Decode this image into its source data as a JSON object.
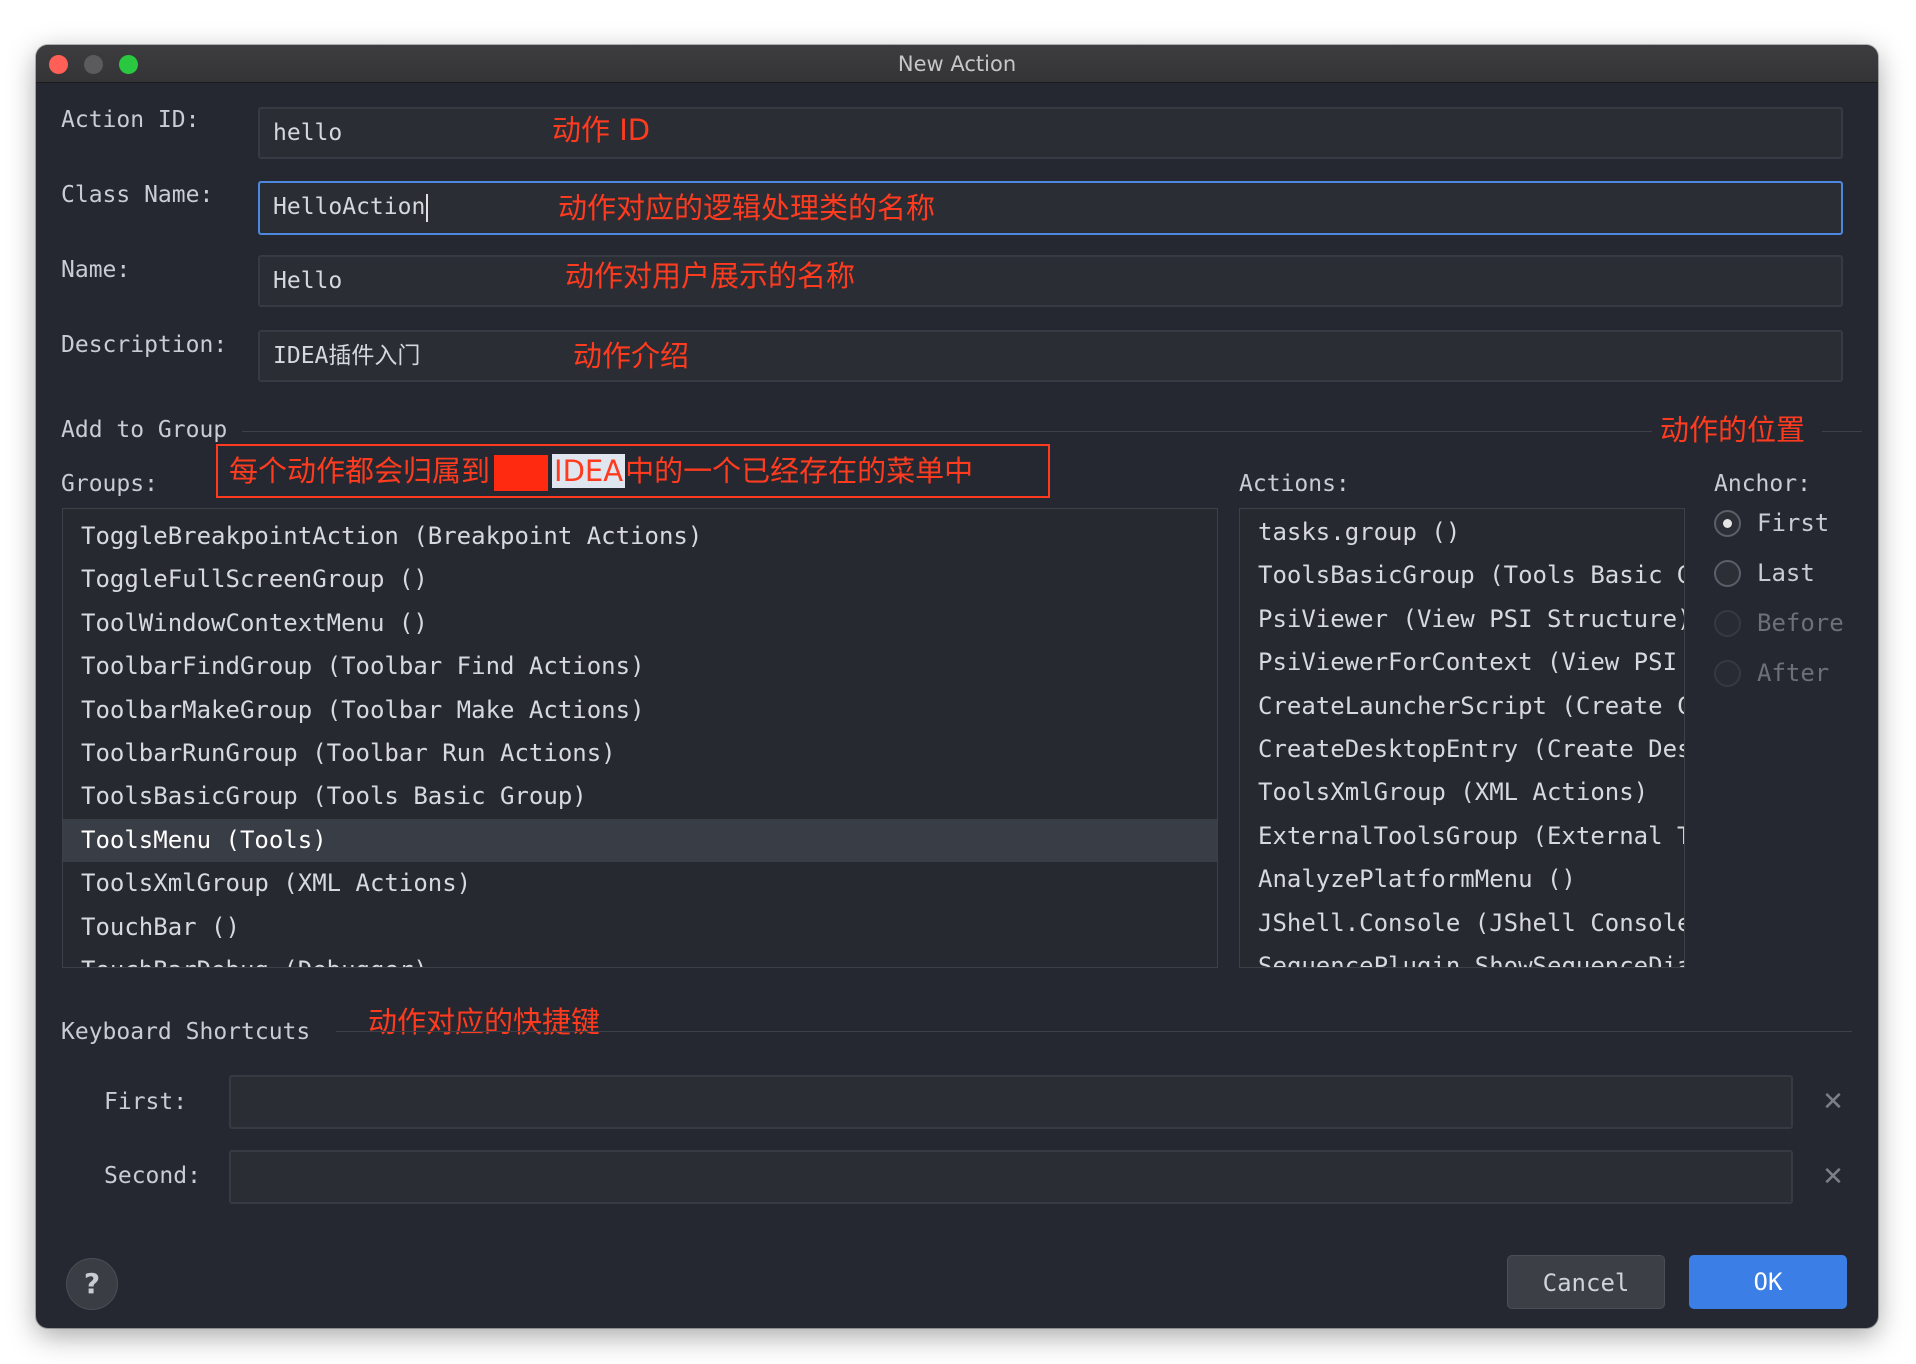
{
  "window": {
    "title": "New Action"
  },
  "form": {
    "action_id": {
      "label": "Action ID:",
      "value": "hello"
    },
    "class_name": {
      "label": "Class Name:",
      "value": "HelloAction"
    },
    "name": {
      "label": "Name:",
      "value": "Hello"
    },
    "description": {
      "label": "Description:",
      "value": "IDEA插件入门"
    }
  },
  "annotations": {
    "action_id": "动作 ID",
    "class_name": "动作对应的逻辑处理类的名称",
    "name": "动作对用户展示的名称",
    "description": "动作介绍",
    "groups_before": "每个动作都会归属到",
    "groups_highlight": "IDEA",
    "groups_after": "中的一个已经存在的菜单中",
    "anchor": "动作的位置",
    "shortcuts": "动作对应的快捷键"
  },
  "add_to_group": {
    "section_label": "Add to Group",
    "groups_label": "Groups:",
    "actions_label": "Actions:",
    "anchor_label": "Anchor:",
    "groups": [
      "ToggleBreakpointAction (Breakpoint Actions)",
      "ToggleFullScreenGroup ()",
      "ToolWindowContextMenu ()",
      "ToolbarFindGroup (Toolbar Find Actions)",
      "ToolbarMakeGroup (Toolbar Make Actions)",
      "ToolbarRunGroup (Toolbar Run Actions)",
      "ToolsBasicGroup (Tools Basic Group)",
      "ToolsMenu (Tools)",
      "ToolsXmlGroup (XML Actions)",
      "TouchBar ()",
      "TouchBarDebug (Debugger)"
    ],
    "selected_group": "ToolsMenu (Tools)",
    "actions": [
      "tasks.group ()",
      "ToolsBasicGroup (Tools Basic Group)",
      "PsiViewer (View PSI Structure)",
      "PsiViewerForContext (View PSI Structure of Current File)",
      "CreateLauncherScript (Create Command-line Launcher...)",
      "CreateDesktopEntry (Create Desktop Entry...)",
      "ToolsXmlGroup (XML Actions)",
      "ExternalToolsGroup (External Tools)",
      "AnalyzePlatformMenu ()",
      "JShell.Console (JShell Console...)",
      "SequencePlugin.ShowSequenceDiagram"
    ],
    "anchors": [
      {
        "label": "First",
        "checked": true,
        "enabled": true
      },
      {
        "label": "Last",
        "checked": false,
        "enabled": true
      },
      {
        "label": "Before",
        "checked": false,
        "enabled": false
      },
      {
        "label": "After",
        "checked": false,
        "enabled": false
      }
    ]
  },
  "shortcuts": {
    "section_label": "Keyboard Shortcuts",
    "first_label": "First:",
    "first_value": "",
    "second_label": "Second:",
    "second_value": ""
  },
  "buttons": {
    "help": "?",
    "cancel": "Cancel",
    "ok": "OK"
  },
  "colors": {
    "accent": "#3a7ee6",
    "annotation": "#ff3b1f",
    "background": "#252830"
  }
}
